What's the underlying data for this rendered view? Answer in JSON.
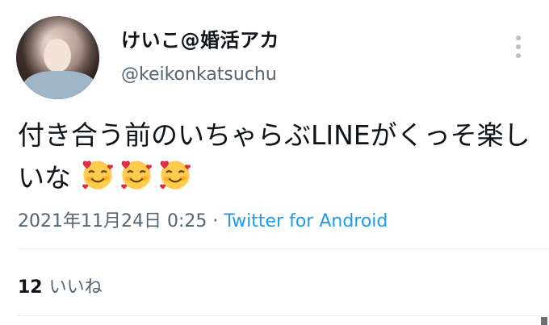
{
  "profile": {
    "display_name": "けいこ@婚活アカ",
    "handle": "@keikonkatsuchu",
    "avatar_icon": "profile-photo"
  },
  "tweet": {
    "text": "付き合う前のいちゃらぶLINEがくっそ楽しいな",
    "emoji": [
      "smiling-face-with-hearts",
      "smiling-face-with-hearts",
      "smiling-face-with-hearts"
    ]
  },
  "meta": {
    "date": "2021年11月24日 0:25",
    "separator": " · ",
    "source": "Twitter for Android"
  },
  "stats": {
    "likes_count": "12",
    "likes_label": "いいね"
  },
  "icons": {
    "more": "more-options-icon"
  },
  "colors": {
    "link": "#1d9bf0",
    "secondary_text": "#536471",
    "primary_text": "#0f1419"
  }
}
